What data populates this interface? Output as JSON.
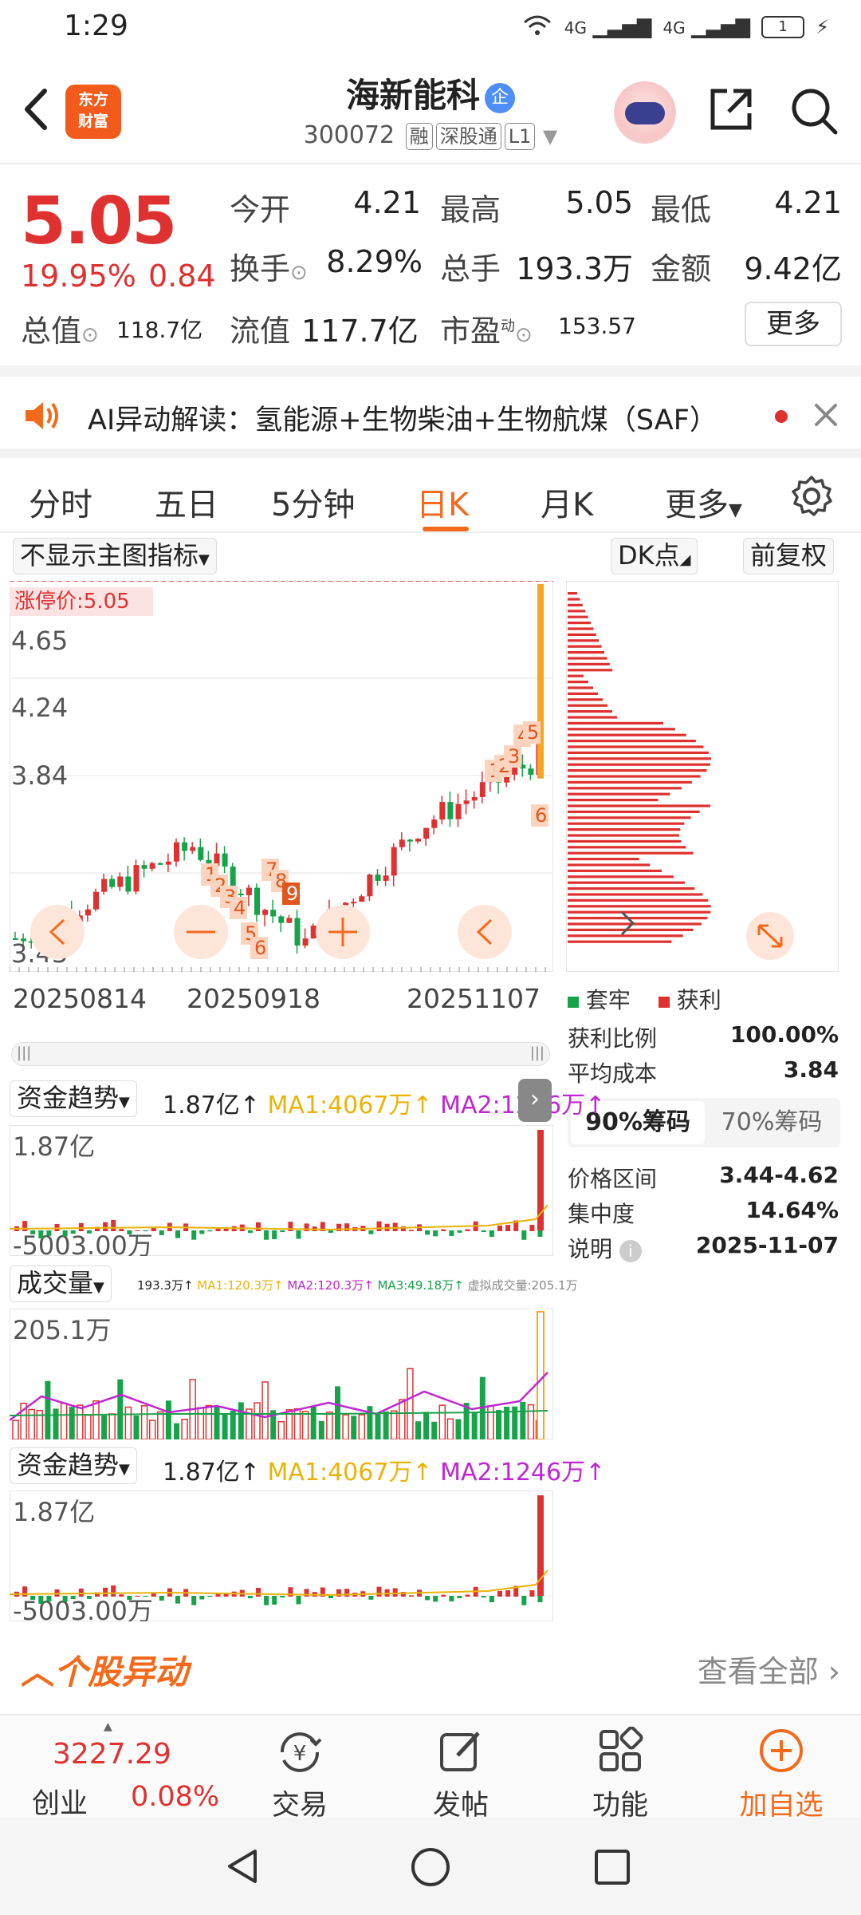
{
  "status": {
    "time": "1:29",
    "net1": "4G",
    "net2": "4G",
    "battery": "1"
  },
  "header": {
    "logo_line1": "东方",
    "logo_line2": "财富",
    "name": "海新能科",
    "badge": "企",
    "code": "300072",
    "tags": [
      "融",
      "深股通",
      "L1"
    ]
  },
  "quote": {
    "price": "5.05",
    "pct": "19.95%",
    "change": "0.84",
    "rows": [
      {
        "l1": "今开",
        "v1": "4.21",
        "l2": "最高",
        "v2": "5.05",
        "l3": "最低",
        "v3": "4.21"
      },
      {
        "l1": "换手",
        "v1": "8.29%",
        "l2": "总手",
        "v2": "193.3万",
        "l3": "金额",
        "v3": "9.42亿"
      }
    ],
    "total_value_label": "总值",
    "total_value": "118.7亿",
    "float_label": "流值",
    "float_value": "117.7亿",
    "pe_label": "市盈",
    "pe_sup": "动",
    "pe_value": "153.57",
    "more": "更多"
  },
  "ai_banner": {
    "text": "AI异动解读：氢能源+生物柴油+生物航煤（SAF）"
  },
  "tabs": [
    "分时",
    "五日",
    "5分钟",
    "日K",
    "月K",
    "更多"
  ],
  "active_tab": "日K",
  "toolbar": {
    "indicator": "不显示主图指标",
    "dk": "DK点",
    "adjust": "前复权"
  },
  "main_chart": {
    "limit_label": "涨停价:5.05",
    "y_labels": [
      "5.05",
      "4.65",
      "4.24",
      "3.84",
      "3.43"
    ],
    "dates": [
      "20250814",
      "20250918",
      "20251107"
    ],
    "markers_a": [
      "1",
      "2",
      "3",
      "4",
      "5",
      "6",
      "7",
      "8",
      "9"
    ],
    "markers_b": [
      "1",
      "2",
      "3",
      "4",
      "5",
      "6"
    ]
  },
  "profile": {
    "legend_trap": "套牢",
    "legend_profit": "获利",
    "stats": [
      {
        "label": "获利比例",
        "value": "100.00%"
      },
      {
        "label": "平均成本",
        "value": "3.84"
      }
    ],
    "tab_90": "90%筹码",
    "tab_70": "70%筹码",
    "stats2": [
      {
        "label": "价格区间",
        "value": "3.44-4.62"
      },
      {
        "label": "集中度",
        "value": "14.64%"
      },
      {
        "label": "说明",
        "value": "2025-11-07"
      }
    ]
  },
  "fund_panel": {
    "label": "资金趋势",
    "value": "1.87亿↑",
    "ma1": "MA1:4067万↑",
    "ma2": "MA2:1246万↑",
    "top": "1.87亿",
    "bottom": "-5003.00万"
  },
  "volume_panel": {
    "label": "成交量",
    "value": "193.3万↑",
    "ma1": "MA1:120.3万↑",
    "ma2": "MA2:120.3万↑",
    "ma3": "MA3:49.18万↑",
    "virtual": "虚拟成交量:205.1万",
    "top": "205.1万"
  },
  "alerts": {
    "title": "个股异动",
    "view_all": "查看全部"
  },
  "bottom_nav": {
    "index_value": "3227.29",
    "index_name": "创业",
    "index_pct": "0.08%",
    "items": [
      "交易",
      "发帖",
      "功能",
      "加自选"
    ]
  },
  "colors": {
    "up": "#e03131",
    "down": "#16a34a",
    "accent": "#f36a1d",
    "ma1": "#eab308",
    "ma2": "#c026d3"
  }
}
